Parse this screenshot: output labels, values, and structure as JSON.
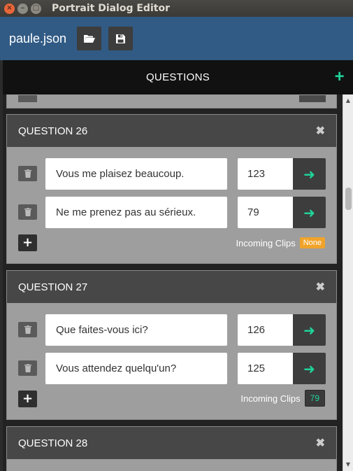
{
  "window": {
    "title": "Portrait Dialog Editor"
  },
  "header": {
    "filename": "paule.json",
    "open_icon": "folder-open-icon",
    "save_icon": "floppy-disk-icon"
  },
  "questions_panel": {
    "title": "QUESTIONS",
    "add_icon": "plus-icon"
  },
  "questions": [
    {
      "title": "QUESTION 26",
      "responses": [
        {
          "text": "Vous me plaisez beaucoup.",
          "clip": "123"
        },
        {
          "text": "Ne me prenez pas au sérieux.",
          "clip": "79"
        }
      ],
      "incoming_label": "Incoming Clips",
      "incoming_value": "None"
    },
    {
      "title": "QUESTION 27",
      "responses": [
        {
          "text": "Que faites-vous ici?",
          "clip": "126"
        },
        {
          "text": "Vous attendez quelqu'un?",
          "clip": "125"
        }
      ],
      "incoming_label": "Incoming Clips",
      "incoming_value": "79"
    },
    {
      "title": "QUESTION 28"
    }
  ],
  "colors": {
    "accent": "#1fd39a",
    "header_bg": "#315b85",
    "warning_badge": "#f0a32a"
  }
}
